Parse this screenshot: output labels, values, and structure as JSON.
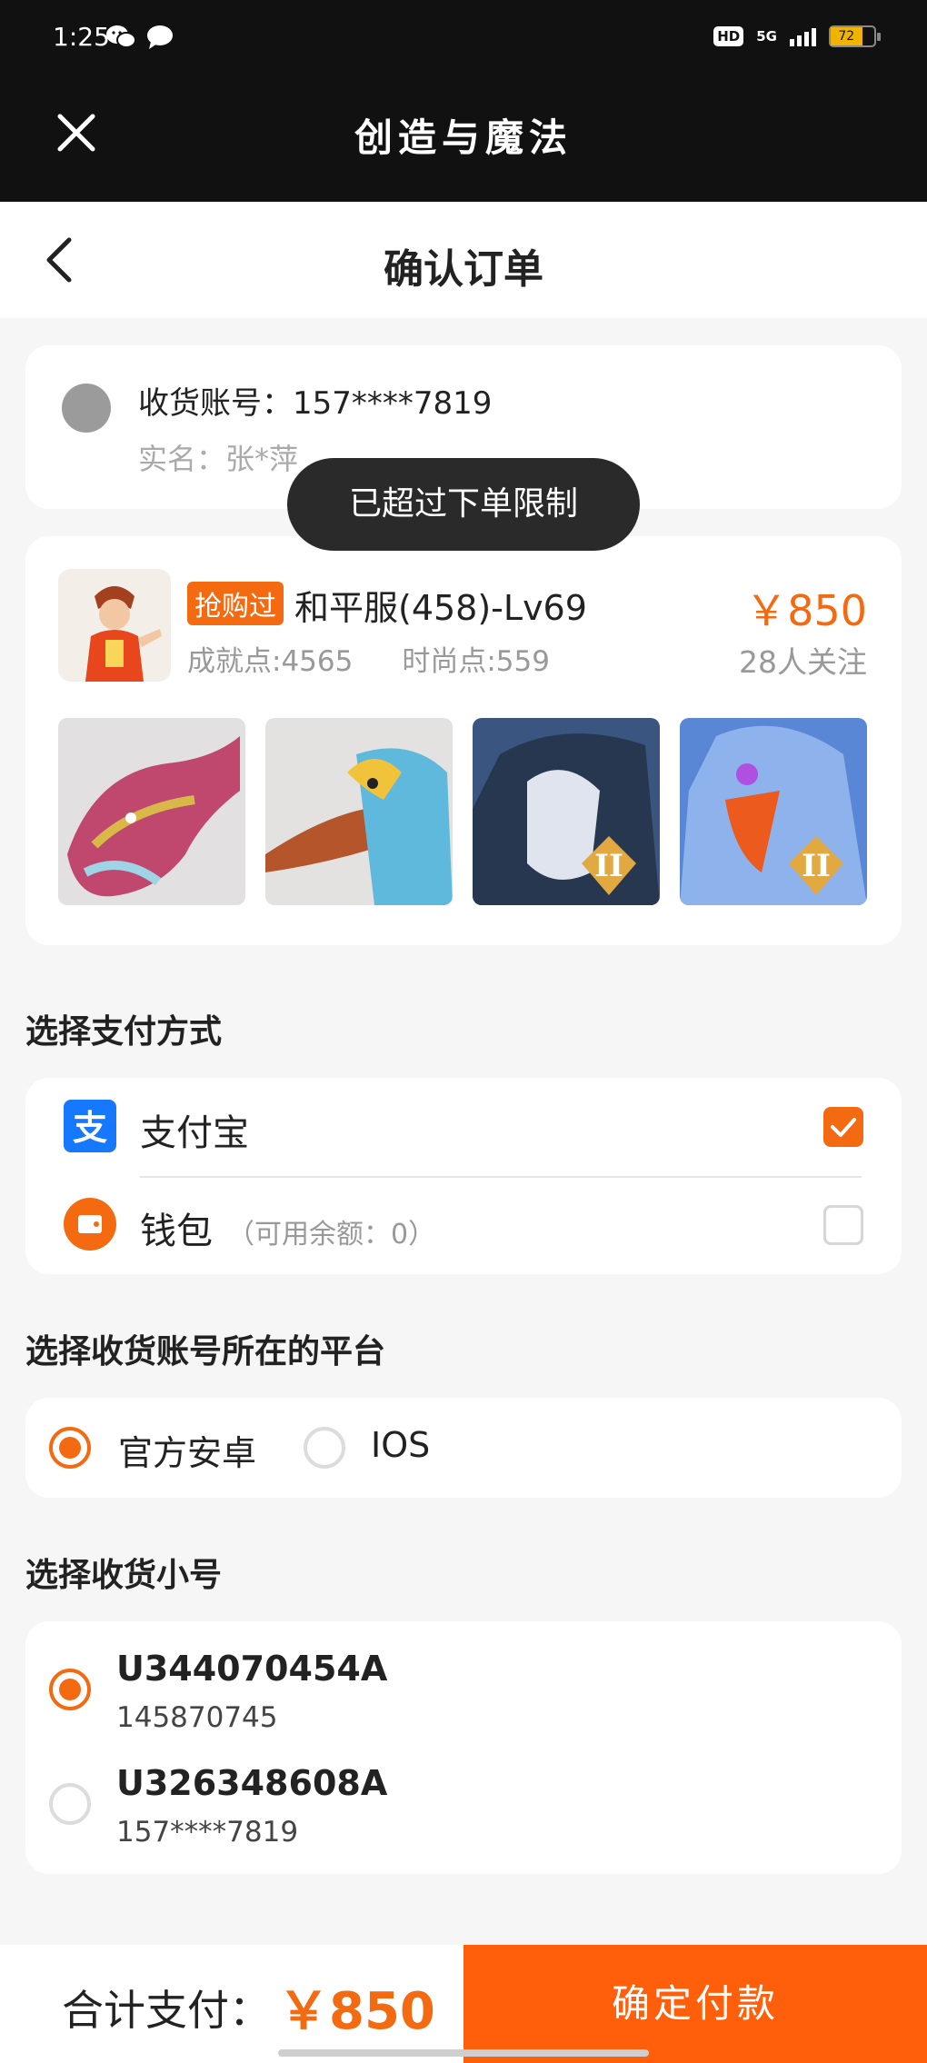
{
  "status_bar": {
    "time": "1:25",
    "hd": "HD",
    "network": "5G",
    "battery": "72"
  },
  "title_bar": {
    "app_title": "创造与魔法",
    "close_icon": "close-icon"
  },
  "nav": {
    "page_title": "确认订单",
    "back_icon": "chevron-left-icon"
  },
  "account": {
    "line": "收货账号：157****7819",
    "name": "实名：张*萍"
  },
  "toast": "已超过下单限制",
  "product": {
    "tag": "抢购过",
    "name": "和平服(458)-Lv69",
    "price": "￥850",
    "follow": "28人关注",
    "achievement": "成就点:4565",
    "fashion": "时尚点:559",
    "thumbnails": [
      "pink-dragon-mount",
      "blue-phoenix-mount",
      "dark-armored-dragon-mount",
      "blue-griffin-mount"
    ]
  },
  "payment": {
    "section_title": "选择支付方式",
    "alipay_label": "支付宝",
    "wallet_label": "钱包",
    "wallet_sub": "（可用余额：0）",
    "selected": "alipay"
  },
  "platform": {
    "section_title": "选择收货账号所在的平台",
    "android_label": "官方安卓",
    "ios_label": "IOS",
    "selected": "android"
  },
  "small_account": {
    "section_title": "选择收货小号",
    "items": [
      {
        "id": "U344070454A",
        "sub": "145870745",
        "selected": true
      },
      {
        "id": "U326348608A",
        "sub": "157****7819",
        "selected": false
      }
    ]
  },
  "footer": {
    "total_label": "合计支付：",
    "total_amount": "￥850",
    "confirm_label": "确定付款"
  },
  "colors": {
    "accent": "#f46a10",
    "button": "#ff5f0a",
    "alipay": "#1677ff"
  }
}
